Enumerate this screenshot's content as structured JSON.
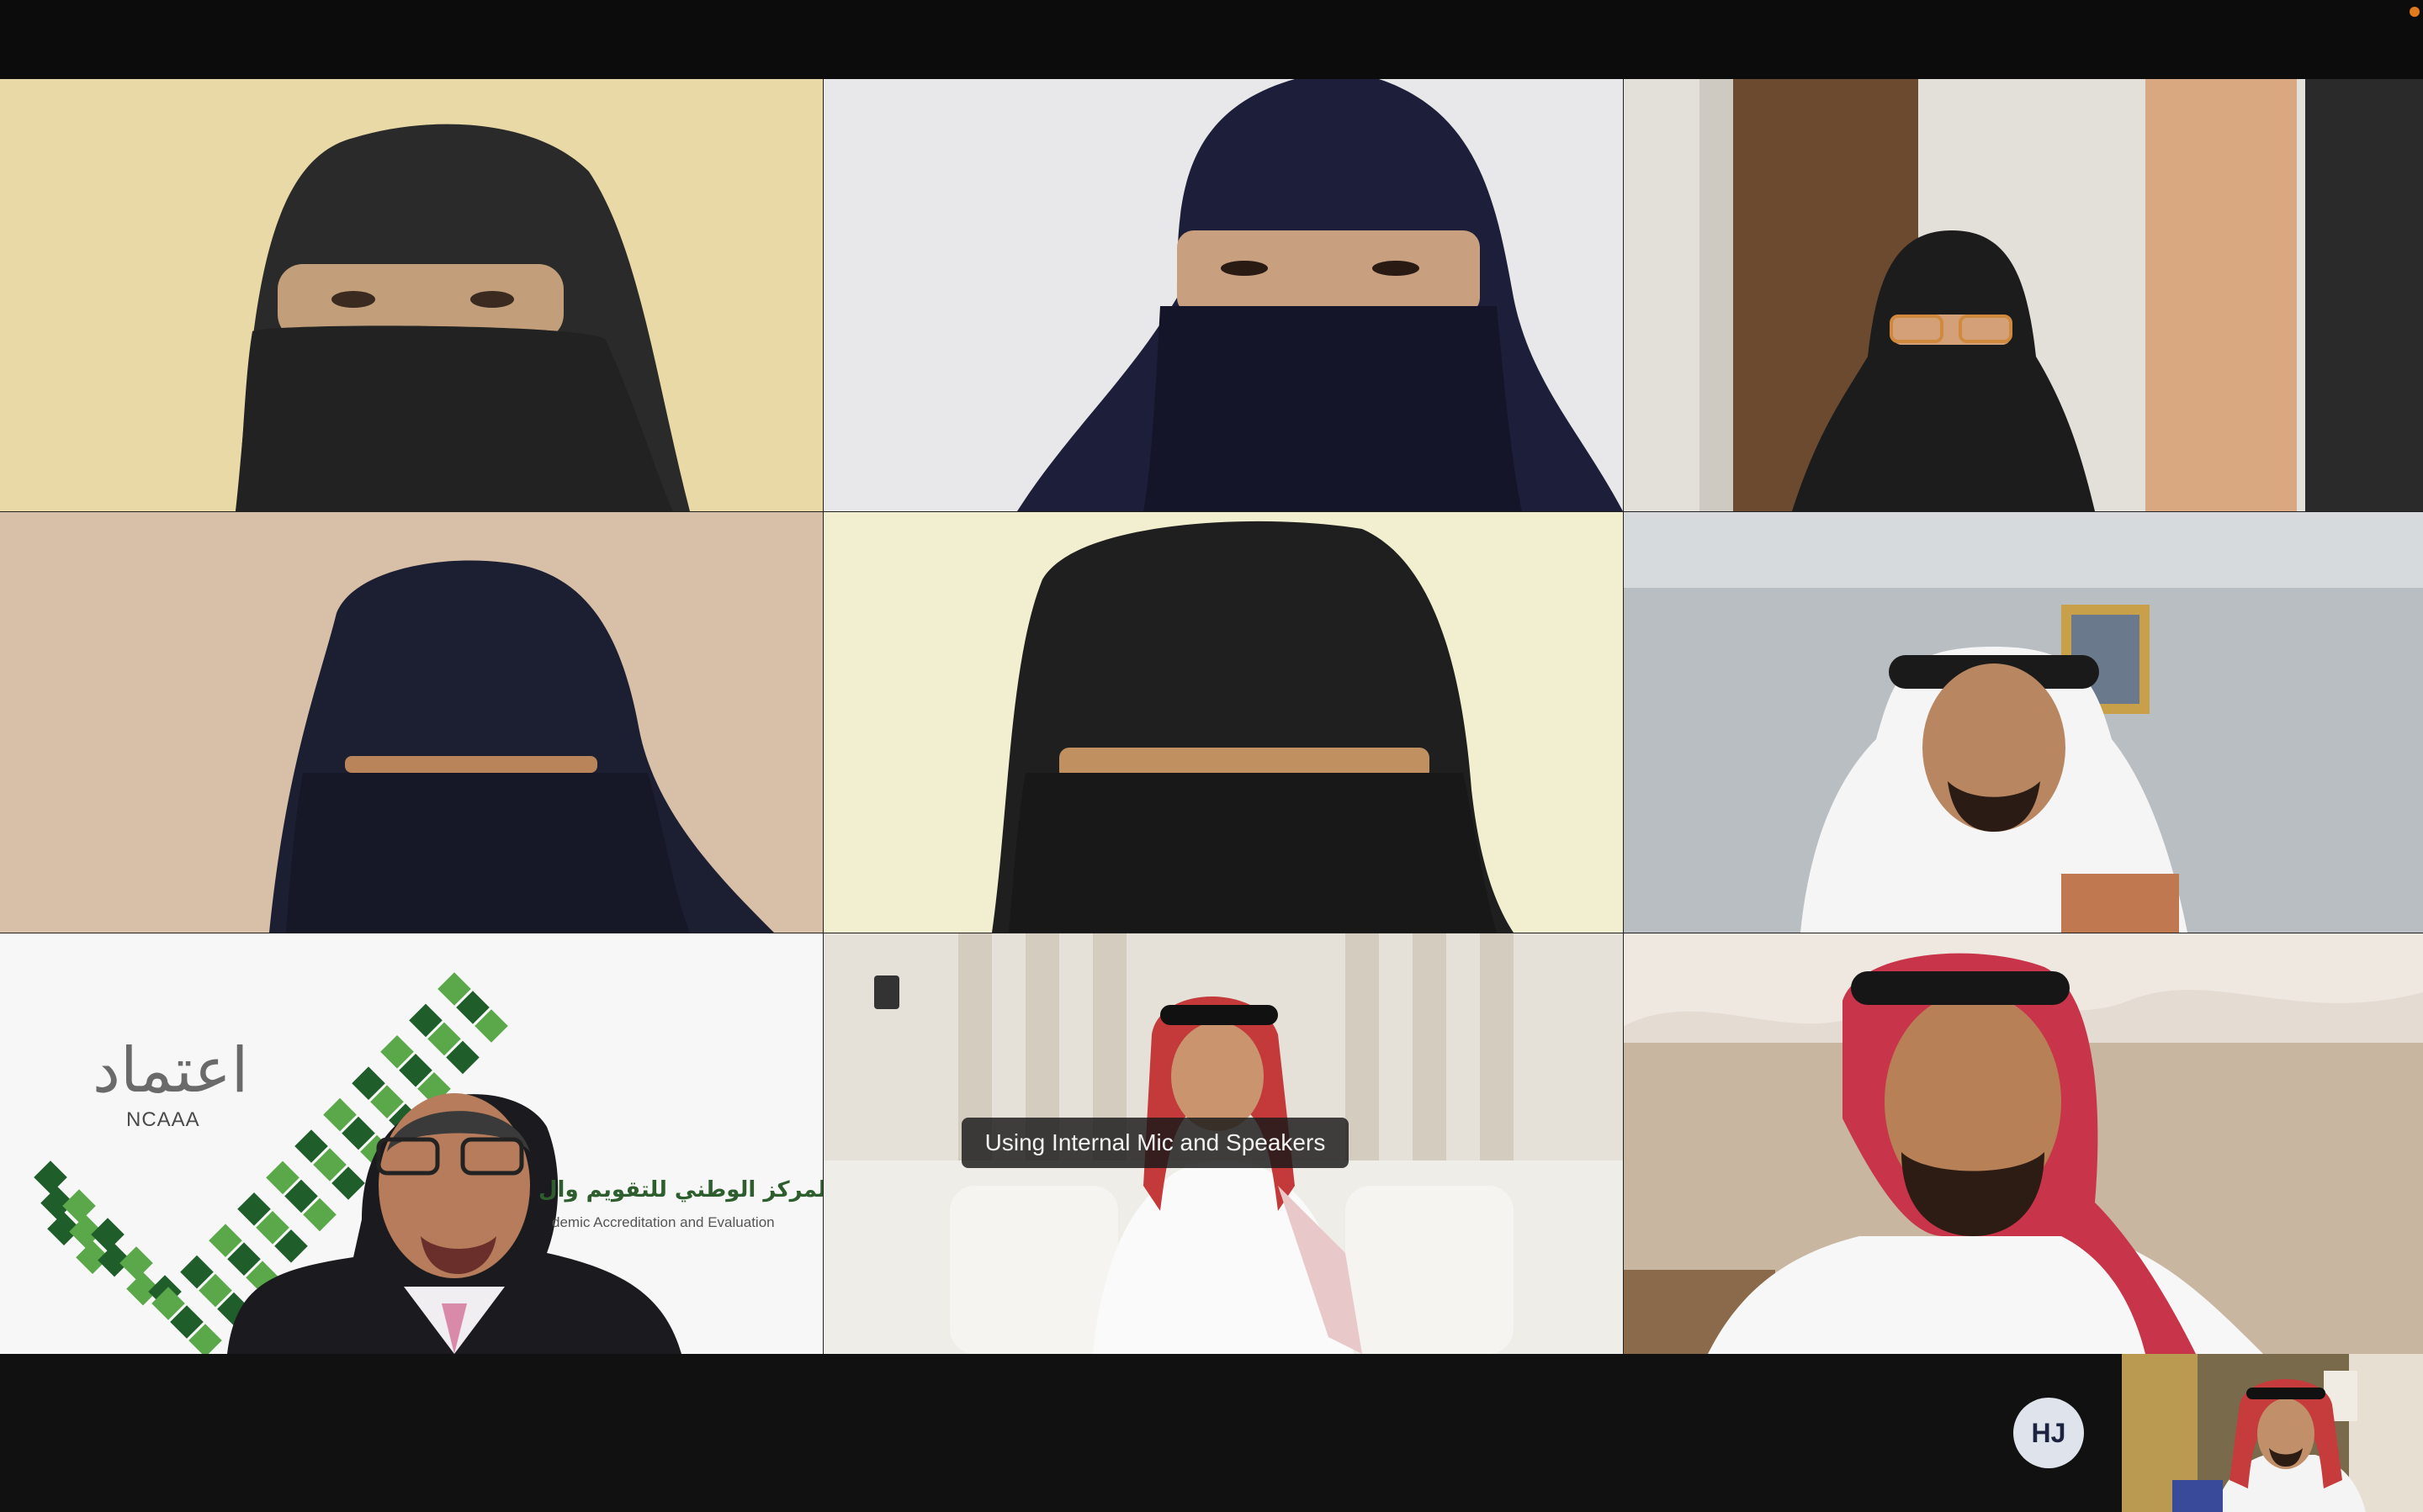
{
  "window": {
    "recording_indicator_color": "#e07a1c"
  },
  "participants": [
    {
      "tile": "top-left",
      "description_icon": "person-video-icon"
    },
    {
      "tile": "top-center",
      "description_icon": "person-video-icon"
    },
    {
      "tile": "top-right",
      "description_icon": "person-video-icon"
    },
    {
      "tile": "middle-left",
      "description_icon": "person-video-icon"
    },
    {
      "tile": "middle-center",
      "description_icon": "person-video-icon"
    },
    {
      "tile": "middle-right",
      "description_icon": "person-video-icon"
    },
    {
      "tile": "bottom-left",
      "description_icon": "person-video-icon"
    },
    {
      "tile": "bottom-center",
      "description_icon": "person-video-icon"
    },
    {
      "tile": "bottom-right",
      "description_icon": "person-video-icon"
    }
  ],
  "ncaaa_logo": {
    "arabic_title": "اعتماد",
    "acronym": "NCAAA",
    "arabic_name": "المركز الوطني للتقويم وال",
    "english_name": "demic Accreditation and Evaluation"
  },
  "audio_toast": {
    "text": "Using Internal Mic and Speakers"
  },
  "bottom_bar": {
    "avatar_initials": "HJ"
  },
  "colors": {
    "background": "#0f0f0f",
    "logo_green_dark": "#1f5d2a",
    "logo_green_light": "#5aa84a"
  }
}
